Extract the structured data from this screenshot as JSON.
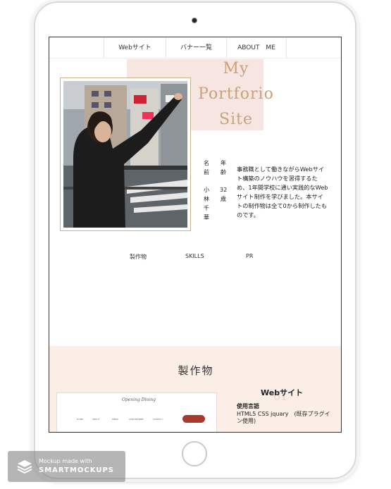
{
  "nav": {
    "items": [
      "Webサイト",
      "バナー一覧",
      "ABOUT　ME"
    ]
  },
  "hero": {
    "title_lines": [
      "My",
      "Portforio",
      "Site"
    ],
    "labels": {
      "name_label": [
        "名",
        "前"
      ],
      "name_value": [
        "小",
        "林",
        "千",
        "華"
      ],
      "age_label": [
        "年",
        "齢"
      ],
      "age_value": [
        "32",
        "歳"
      ]
    },
    "intro": "事務職として働きながらWebサイト構築のノウハウを習得するため、1年間学校に通い実践的なWebサイト制作を学びました。本サイトの制作物は全て0から制作したものです。"
  },
  "tabs": [
    "製作物",
    "SKILLS",
    "PR"
  ],
  "works": {
    "title": "製作物",
    "number": "01",
    "item_title": "Webサイト",
    "used_label": "使用言語",
    "used_text": "HTML5 CSS jquary　(既存プラグイン使用)",
    "thumb": {
      "logo": "Opening Dining",
      "nav": [
        "HOME",
        "ABOUT",
        "MENU",
        "ATMOSPHERE",
        "CONTACT"
      ]
    }
  },
  "watermark": {
    "line1": "Mockup made with",
    "line2": "SMARTMOCKUPS"
  },
  "colors": {
    "accent_title": "#c9a27a",
    "pink_bg": "#f6e5e0",
    "section_bg": "#faeee6",
    "thumb_button": "#a7392d"
  }
}
